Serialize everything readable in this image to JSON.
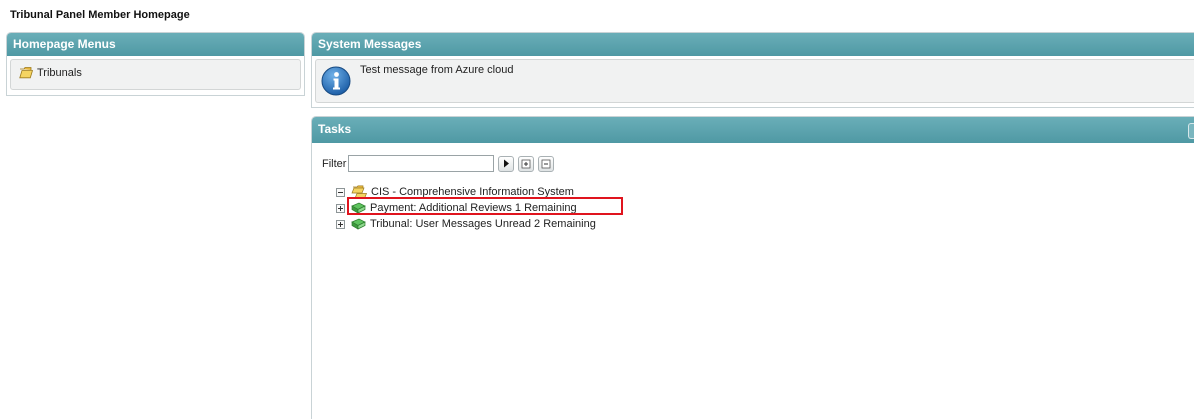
{
  "page": {
    "title": "Tribunal Panel Member Homepage"
  },
  "menu_panel": {
    "header": "Homepage Menus",
    "items": [
      {
        "label": "Tribunals",
        "icon": "folder-icon"
      }
    ]
  },
  "messages_panel": {
    "header": "System Messages",
    "messages": [
      {
        "text": "Test message from Azure cloud",
        "icon": "info-icon"
      }
    ]
  },
  "tasks_panel": {
    "header": "Tasks",
    "filter": {
      "label": "Filter",
      "value": "",
      "placeholder": ""
    },
    "tree": {
      "root": {
        "label": "CIS - Comprehensive Information System",
        "expanded": true,
        "icon": "folder-group-icon"
      },
      "children": [
        {
          "label": "Payment: Additional Reviews 1 Remaining",
          "icon": "book-icon",
          "highlighted": true
        },
        {
          "label": "Tribunal: User Messages Unread 2 Remaining",
          "icon": "book-icon",
          "highlighted": false
        }
      ]
    }
  },
  "colors": {
    "header_bg": "#559ea9",
    "highlight": "#e0141e",
    "panel_body": "#f1f2f2"
  }
}
